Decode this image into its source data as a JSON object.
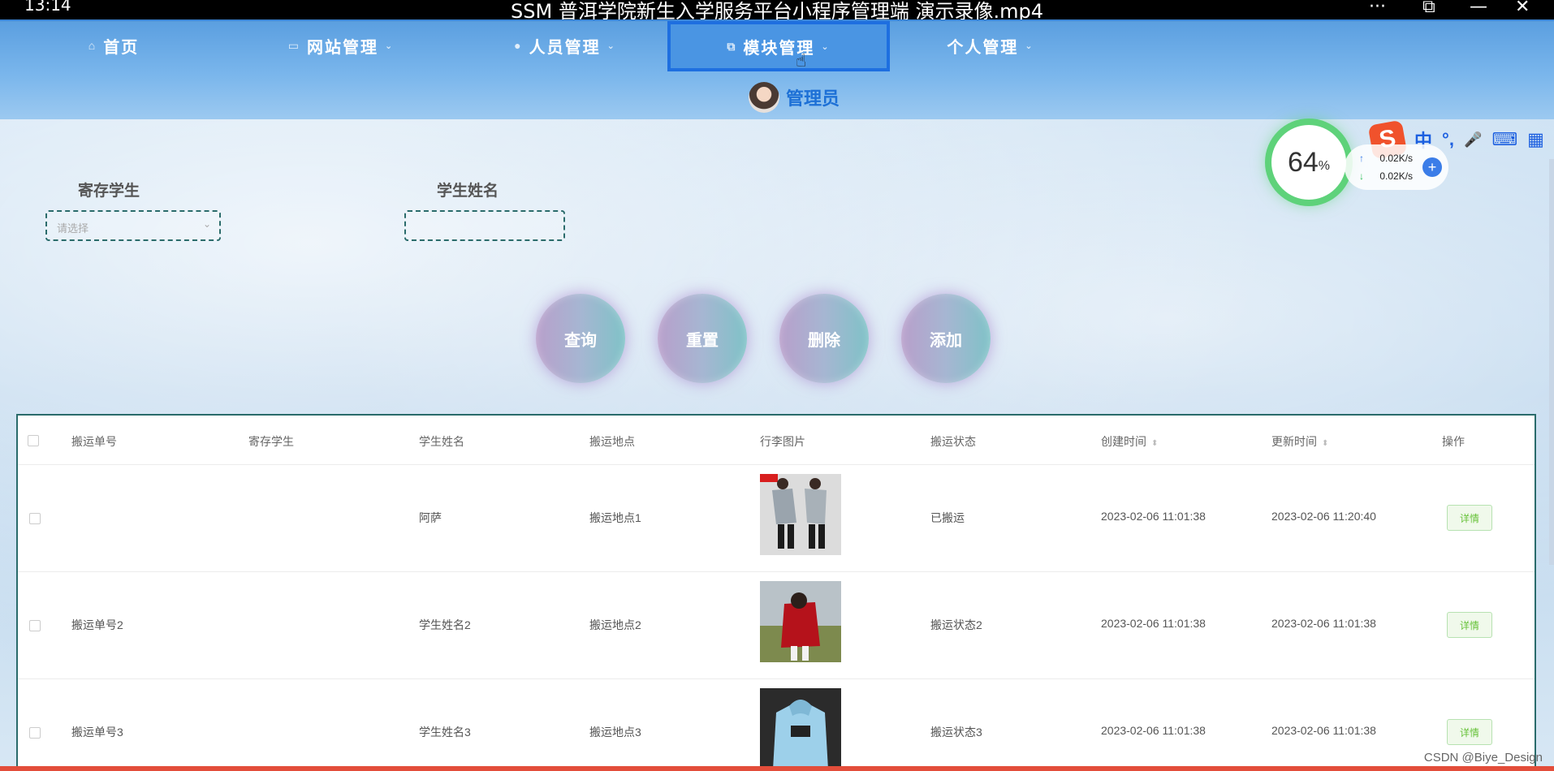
{
  "player": {
    "time": "13:14",
    "title": "SSM 普洱学院新生入学服务平台小程序管理端 演示录像.mp4",
    "controls": [
      "···",
      "⧉",
      "—",
      "✕"
    ]
  },
  "nav": {
    "items": [
      {
        "label": "首页",
        "icon": "home-icon",
        "glyph": "⌂",
        "chev": ""
      },
      {
        "label": "网站管理",
        "icon": "monitor-icon",
        "glyph": "▭",
        "chev": "⌄"
      },
      {
        "label": "人员管理",
        "icon": "person-icon",
        "glyph": "●",
        "chev": "⌄"
      },
      {
        "label": "模块管理",
        "icon": "module-icon",
        "glyph": "⧉",
        "chev": "⌄"
      },
      {
        "label": "个人管理",
        "icon": "user-icon",
        "glyph": "",
        "chev": "⌄"
      }
    ],
    "active": "模块管理",
    "user_name": "管理员"
  },
  "filters": {
    "student_label": "寄存学生",
    "student_placeholder": "请选择",
    "name_label": "学生姓名",
    "name_value": ""
  },
  "actions": {
    "query": "查询",
    "reset": "重置",
    "delete": "删除",
    "add": "添加"
  },
  "speed_widget": {
    "percent": "64",
    "percent_unit": "%",
    "up": "0.02K/s",
    "down": "0.02K/s",
    "up_glyph": "↑",
    "down_glyph": "↓"
  },
  "ime": {
    "logo": "S",
    "lang": "中",
    "punct": "°,",
    "mic": "🎤",
    "kbd": "⌨",
    "grid": "▦"
  },
  "table": {
    "headers": [
      "搬运单号",
      "寄存学生",
      "学生姓名",
      "搬运地点",
      "行李图片",
      "搬运状态",
      "创建时间",
      "更新时间",
      "操作"
    ],
    "sortable_glyph": "⬍",
    "rows": [
      {
        "no": "",
        "student": "",
        "name": "阿萨",
        "place": "搬运地点1",
        "status": "已搬运",
        "created": "2023-02-06 11:01:38",
        "updated": "2023-02-06 11:20:40",
        "action": "详情"
      },
      {
        "no": "搬运单号2",
        "student": "",
        "name": "学生姓名2",
        "place": "搬运地点2",
        "status": "搬运状态2",
        "created": "2023-02-06 11:01:38",
        "updated": "2023-02-06 11:01:38",
        "action": "详情"
      },
      {
        "no": "搬运单号3",
        "student": "",
        "name": "学生姓名3",
        "place": "搬运地点3",
        "status": "搬运状态3",
        "created": "2023-02-06 11:01:38",
        "updated": "2023-02-06 11:01:38",
        "action": "详情"
      }
    ]
  },
  "watermark": "CSDN @Biye_Design"
}
